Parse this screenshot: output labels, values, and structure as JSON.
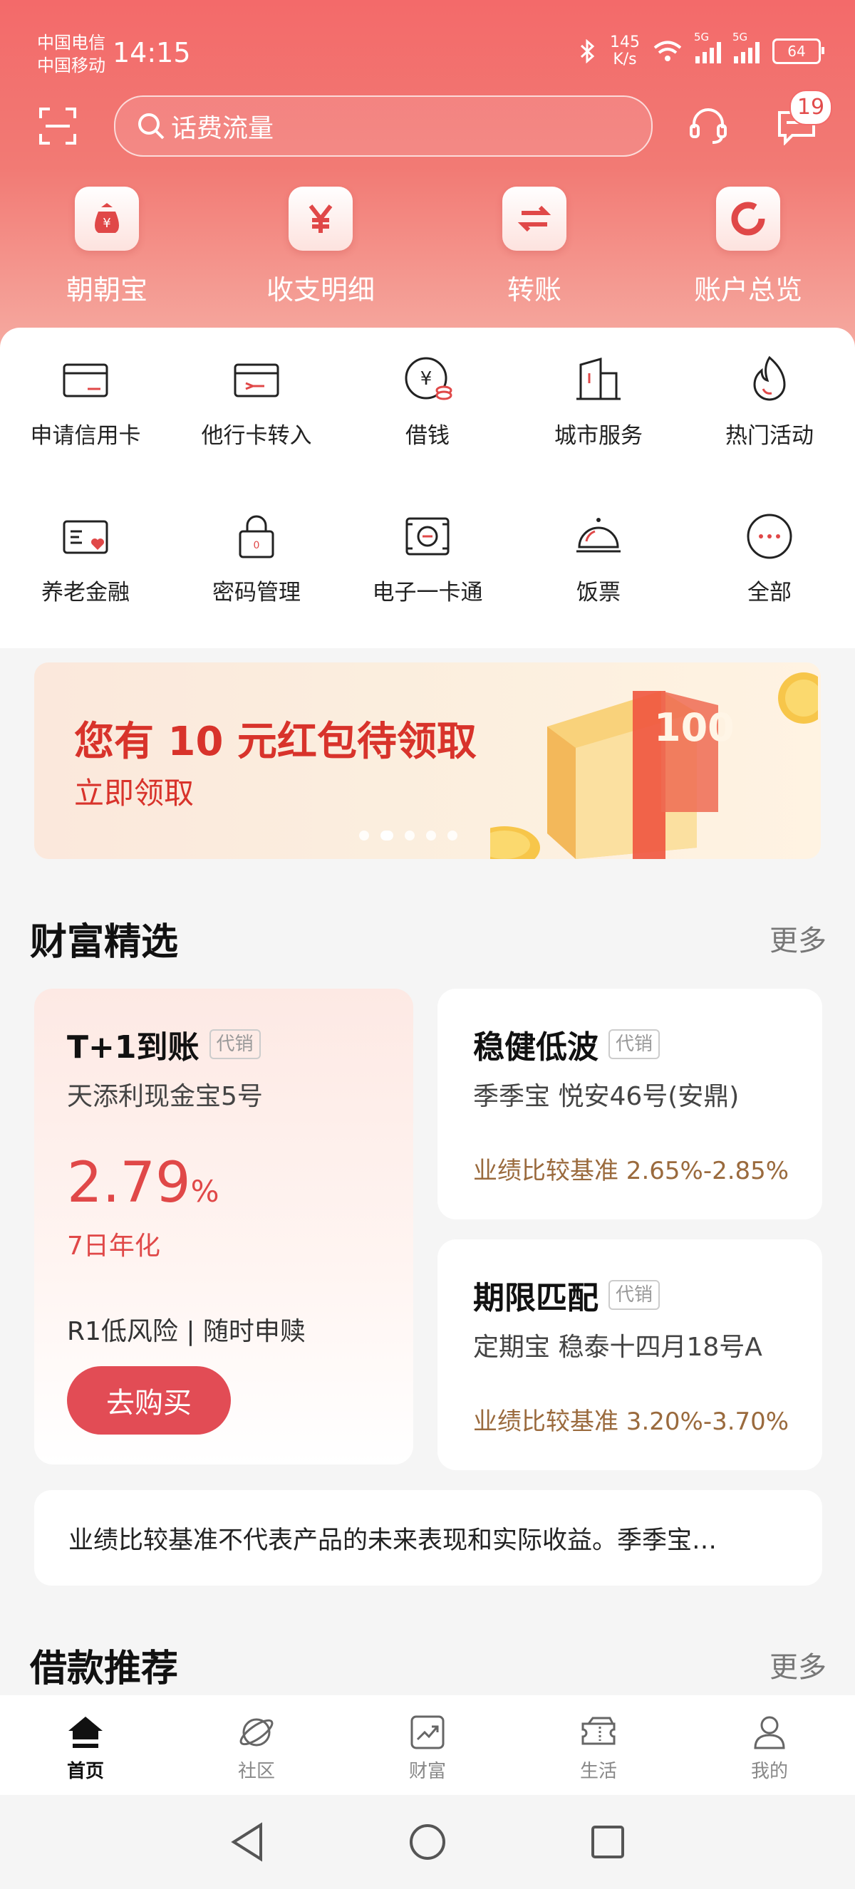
{
  "status_bar": {
    "carrier1": "中国电信",
    "carrier2": "中国移动",
    "time": "14:15",
    "speed_value": "145",
    "speed_unit": "K/s",
    "net1": "5G",
    "net2": "5G",
    "battery": "64"
  },
  "header": {
    "search_placeholder": "话费流量",
    "message_badge": "19"
  },
  "quick_actions": [
    {
      "label": "朝朝宝",
      "icon": "money-bag-icon"
    },
    {
      "label": "收支明细",
      "icon": "yuan-icon"
    },
    {
      "label": "转账",
      "icon": "transfer-icon"
    },
    {
      "label": "账户总览",
      "icon": "ring-chart-icon"
    }
  ],
  "services_row1": [
    {
      "label": "申请信用卡",
      "icon": "credit-card-icon"
    },
    {
      "label": "他行卡转入",
      "icon": "card-transfer-icon"
    },
    {
      "label": "借钱",
      "icon": "loan-icon"
    },
    {
      "label": "城市服务",
      "icon": "city-icon"
    },
    {
      "label": "热门活动",
      "icon": "flame-icon"
    }
  ],
  "services_row2": [
    {
      "label": "养老金融",
      "icon": "pension-card-icon"
    },
    {
      "label": "密码管理",
      "icon": "lock-icon"
    },
    {
      "label": "电子一卡通",
      "icon": "e-card-icon"
    },
    {
      "label": "饭票",
      "icon": "dining-bell-icon"
    },
    {
      "label": "全部",
      "icon": "more-dots-icon"
    }
  ],
  "banner": {
    "title": "您有 10 元红包待领取",
    "subtitle": "立即领取",
    "image_text": "100"
  },
  "wealth": {
    "title": "财富精选",
    "more": "更多",
    "featured": {
      "title": "T+1到账",
      "tag": "代销",
      "product": "天添利现金宝5号",
      "rate": "2.79",
      "rate_unit": "%",
      "rate_label": "7日年化",
      "risk": "R1低风险 | 随时申赎",
      "button": "去购买"
    },
    "cards": [
      {
        "title": "稳健低波",
        "tag": "代销",
        "product": "季季宝  悦安46号(安鼎)",
        "perf": "业绩比较基准 2.65%-2.85%"
      },
      {
        "title": "期限匹配",
        "tag": "代销",
        "product": "定期宝  稳泰十四月18号A",
        "perf": "业绩比较基准 3.20%-3.70%"
      }
    ],
    "notice": "业绩比较基准不代表产品的未来表现和实际收益。季季宝…"
  },
  "loans": {
    "title": "借款推荐",
    "more": "更多"
  },
  "tabbar": [
    {
      "label": "首页",
      "icon": "home-icon",
      "active": true
    },
    {
      "label": "社区",
      "icon": "planet-icon",
      "active": false
    },
    {
      "label": "财富",
      "icon": "trend-chart-icon",
      "active": false
    },
    {
      "label": "生活",
      "icon": "ticket-icon",
      "active": false
    },
    {
      "label": "我的",
      "icon": "person-icon",
      "active": false
    }
  ],
  "colors": {
    "brand_red": "#e24c55",
    "header_gradient_top": "#f36a6a",
    "perf_brown": "#9a6a3d"
  }
}
